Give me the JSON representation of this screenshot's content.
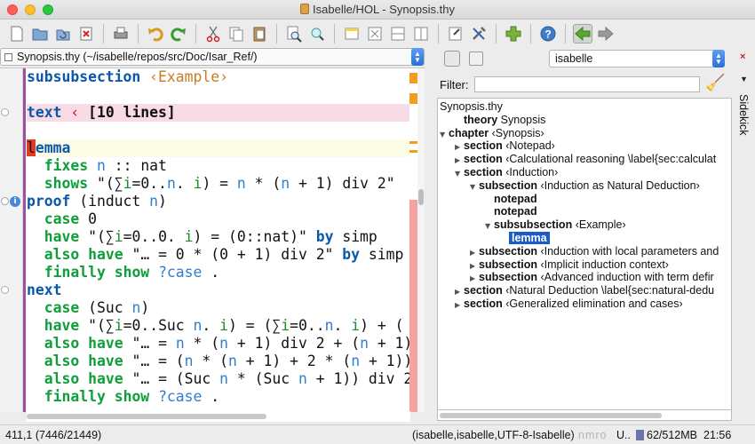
{
  "window": {
    "title": "Isabelle/HOL - Synopsis.thy"
  },
  "toolbar": {
    "icons": [
      "new-file",
      "open",
      "reload",
      "close-buffer",
      "print",
      "undo",
      "redo",
      "cut",
      "copy",
      "paste",
      "find",
      "find-replace",
      "new-view",
      "unsplit",
      "split-horizontal",
      "split-vertical",
      "buffer-options",
      "global-options",
      "plugin-manager",
      "help",
      "back",
      "forward"
    ]
  },
  "editor": {
    "buffer_label": "Synopsis.thy (~/isabelle/repos/src/Doc/Isar_Ref/)",
    "lines": [
      [
        {
          "t": "subsubsection",
          "c": "kw1"
        },
        {
          "t": " "
        },
        {
          "t": "‹Example›",
          "c": "cart"
        }
      ],
      [
        {
          "t": ""
        }
      ],
      [
        {
          "t": "text",
          "c": "kw1"
        },
        {
          "t": " "
        },
        {
          "t": "‹",
          "c": "red"
        },
        {
          "t": " [10 lines]",
          "c": "b"
        }
      ],
      [
        {
          "t": ""
        }
      ],
      [
        {
          "t": "l",
          "c": "lcursor"
        },
        {
          "t": "emma",
          "c": "kw1"
        }
      ],
      [
        {
          "t": "  "
        },
        {
          "t": "fixes",
          "c": "kw2"
        },
        {
          "t": " "
        },
        {
          "t": "n",
          "c": "var"
        },
        {
          "t": " :: nat"
        }
      ],
      [
        {
          "t": "  "
        },
        {
          "t": "shows",
          "c": "kw2"
        },
        {
          "t": " \"(∑"
        },
        {
          "t": "i",
          "c": "bvar"
        },
        {
          "t": "=0.."
        },
        {
          "t": "n",
          "c": "var"
        },
        {
          "t": ". "
        },
        {
          "t": "i",
          "c": "bvar"
        },
        {
          "t": ") = "
        },
        {
          "t": "n",
          "c": "var"
        },
        {
          "t": " * ("
        },
        {
          "t": "n",
          "c": "var"
        },
        {
          "t": " + 1) div 2\""
        }
      ],
      [
        {
          "t": "proof",
          "c": "kw1"
        },
        {
          "t": " (induct "
        },
        {
          "t": "n",
          "c": "var"
        },
        {
          "t": ")"
        }
      ],
      [
        {
          "t": "  "
        },
        {
          "t": "case",
          "c": "kw2"
        },
        {
          "t": " 0"
        }
      ],
      [
        {
          "t": "  "
        },
        {
          "t": "have",
          "c": "kw2"
        },
        {
          "t": " \"(∑"
        },
        {
          "t": "i",
          "c": "bvar"
        },
        {
          "t": "=0..0. "
        },
        {
          "t": "i",
          "c": "bvar"
        },
        {
          "t": ") = (0::nat)\" "
        },
        {
          "t": "by",
          "c": "kw1"
        },
        {
          "t": " simp"
        }
      ],
      [
        {
          "t": "  "
        },
        {
          "t": "also",
          "c": "kw2"
        },
        {
          "t": " "
        },
        {
          "t": "have",
          "c": "kw2"
        },
        {
          "t": " \"… = 0 * (0 + 1) div 2\" "
        },
        {
          "t": "by",
          "c": "kw1"
        },
        {
          "t": " simp"
        }
      ],
      [
        {
          "t": "  "
        },
        {
          "t": "finally",
          "c": "kw2"
        },
        {
          "t": " "
        },
        {
          "t": "show",
          "c": "kw2"
        },
        {
          "t": " "
        },
        {
          "t": "?case",
          "c": "var"
        },
        {
          "t": " ."
        }
      ],
      [
        {
          "t": "next",
          "c": "kw1"
        }
      ],
      [
        {
          "t": "  "
        },
        {
          "t": "case",
          "c": "kw2"
        },
        {
          "t": " (Suc "
        },
        {
          "t": "n",
          "c": "var"
        },
        {
          "t": ")"
        }
      ],
      [
        {
          "t": "  "
        },
        {
          "t": "have",
          "c": "kw2"
        },
        {
          "t": " \"(∑"
        },
        {
          "t": "i",
          "c": "bvar"
        },
        {
          "t": "=0..Suc "
        },
        {
          "t": "n",
          "c": "var"
        },
        {
          "t": ". "
        },
        {
          "t": "i",
          "c": "bvar"
        },
        {
          "t": ") = (∑"
        },
        {
          "t": "i",
          "c": "bvar"
        },
        {
          "t": "=0.."
        },
        {
          "t": "n",
          "c": "var"
        },
        {
          "t": ". "
        },
        {
          "t": "i",
          "c": "bvar"
        },
        {
          "t": ") + ("
        }
      ],
      [
        {
          "t": "  "
        },
        {
          "t": "also",
          "c": "kw2"
        },
        {
          "t": " "
        },
        {
          "t": "have",
          "c": "kw2"
        },
        {
          "t": " \"… = "
        },
        {
          "t": "n",
          "c": "var"
        },
        {
          "t": " * ("
        },
        {
          "t": "n",
          "c": "var"
        },
        {
          "t": " + 1) div 2 + ("
        },
        {
          "t": "n",
          "c": "var"
        },
        {
          "t": " + 1)"
        }
      ],
      [
        {
          "t": "  "
        },
        {
          "t": "also",
          "c": "kw2"
        },
        {
          "t": " "
        },
        {
          "t": "have",
          "c": "kw2"
        },
        {
          "t": " \"… = ("
        },
        {
          "t": "n",
          "c": "var"
        },
        {
          "t": " * ("
        },
        {
          "t": "n",
          "c": "var"
        },
        {
          "t": " + 1) + 2 * ("
        },
        {
          "t": "n",
          "c": "var"
        },
        {
          "t": " + 1))"
        }
      ],
      [
        {
          "t": "  "
        },
        {
          "t": "also",
          "c": "kw2"
        },
        {
          "t": " "
        },
        {
          "t": "have",
          "c": "kw2"
        },
        {
          "t": " \"… = (Suc "
        },
        {
          "t": "n",
          "c": "var"
        },
        {
          "t": " * (Suc "
        },
        {
          "t": "n",
          "c": "var"
        },
        {
          "t": " + 1)) div 2"
        }
      ],
      [
        {
          "t": "  "
        },
        {
          "t": "finally",
          "c": "kw2"
        },
        {
          "t": " "
        },
        {
          "t": "show",
          "c": "kw2"
        },
        {
          "t": " "
        },
        {
          "t": "?case",
          "c": "var"
        },
        {
          "t": " ."
        }
      ]
    ]
  },
  "sidekick": {
    "parser": "isabelle",
    "filter_label": "Filter:",
    "filter_value": "",
    "tab_label": "Sidekick",
    "tree": [
      {
        "depth": 0,
        "tri": "",
        "kw": "",
        "text": "Synopsis.thy"
      },
      {
        "depth": 1,
        "tri": "",
        "kw": "theory",
        "text": " Synopsis"
      },
      {
        "depth": 0,
        "tri": "▼",
        "kw": "chapter",
        "text": " ‹Synopsis›"
      },
      {
        "depth": 1,
        "tri": "▶",
        "kw": "section",
        "text": " ‹Notepad›"
      },
      {
        "depth": 1,
        "tri": "▶",
        "kw": "section",
        "text": " ‹Calculational reasoning \\label{sec:calculat"
      },
      {
        "depth": 1,
        "tri": "▼",
        "kw": "section",
        "text": " ‹Induction›"
      },
      {
        "depth": 2,
        "tri": "▼",
        "kw": "subsection",
        "text": " ‹Induction as Natural Deduction›"
      },
      {
        "depth": 3,
        "tri": "",
        "kw": "notepad",
        "text": ""
      },
      {
        "depth": 3,
        "tri": "",
        "kw": "notepad",
        "text": ""
      },
      {
        "depth": 3,
        "tri": "▼",
        "kw": "subsubsection",
        "text": " ‹Example›"
      },
      {
        "depth": 4,
        "tri": "",
        "kw": "lemma",
        "text": "",
        "selected": true
      },
      {
        "depth": 2,
        "tri": "▶",
        "kw": "subsection",
        "text": " ‹Induction with local parameters and"
      },
      {
        "depth": 2,
        "tri": "▶",
        "kw": "subsection",
        "text": " ‹Implicit induction context›"
      },
      {
        "depth": 2,
        "tri": "▶",
        "kw": "subsection",
        "text": " ‹Advanced induction with term defir"
      },
      {
        "depth": 1,
        "tri": "▶",
        "kw": "section",
        "text": " ‹Natural Deduction \\label{sec:natural-dedu"
      },
      {
        "depth": 1,
        "tri": "▶",
        "kw": "section",
        "text": " ‹Generalized elimination and cases›"
      }
    ]
  },
  "status": {
    "position": "411,1 (7446/21449)",
    "mode": "(isabelle,isabelle,UTF-8-Isabelle)",
    "flags": "nmro",
    "u_flag": "U..",
    "memory": "62/512MB",
    "clock": "21:56"
  },
  "colors": {
    "keyword": "#0a58aa",
    "proof_keyword": "#109e3a",
    "cartouche": "#c77c1e",
    "free_var": "#2f7ed0",
    "bound_var": "#1c8a2c",
    "selection": "#1c5bc7"
  }
}
